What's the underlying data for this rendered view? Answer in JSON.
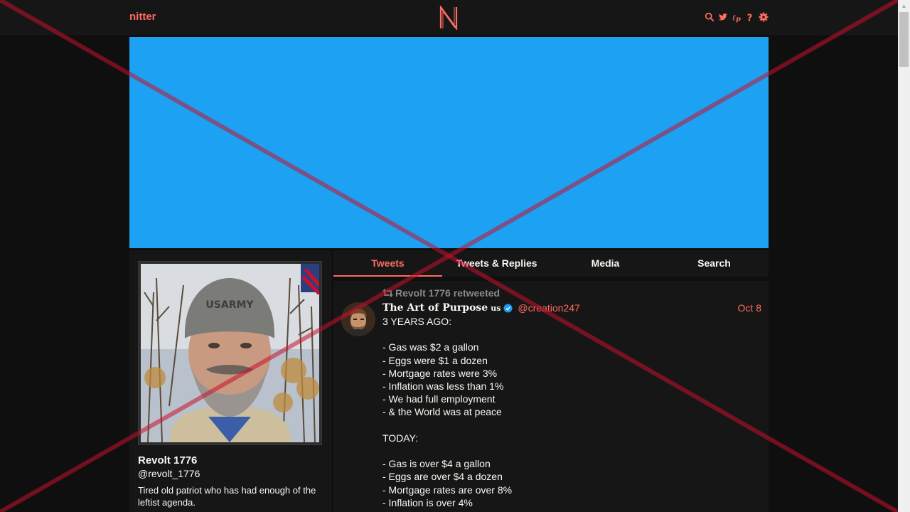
{
  "navbar": {
    "brand": "nitter",
    "logo_letter": "N",
    "icons": [
      "search-icon",
      "twitter-bird-icon",
      "rss-icon",
      "help-icon",
      "gear-icon"
    ]
  },
  "banner": {
    "color": "#1da1f2"
  },
  "profile": {
    "name": "Revolt 1776",
    "handle": "@revolt_1776",
    "bio": "Tired old patriot who has had enough of the leftist agenda.",
    "beanie_text": "USARMY"
  },
  "tabs": [
    {
      "label": "Tweets",
      "active": true
    },
    {
      "label": "Tweets & Replies",
      "active": false
    },
    {
      "label": "Media",
      "active": false
    },
    {
      "label": "Search",
      "active": false
    }
  ],
  "tweet": {
    "retweet_header": "Revolt 1776 retweeted",
    "fullname": "The Art of Purpose",
    "flag": "us",
    "verified": true,
    "username": "@creation247",
    "date": "Oct 8",
    "lines": [
      "3 YEARS AGO:",
      "",
      "- Gas was $2 a gallon",
      "- Eggs were $1 a dozen",
      "- Mortgage rates were 3%",
      "- Inflation was less than 1%",
      "- We had full employment",
      "- & the World was at peace",
      "",
      "TODAY:",
      "",
      "- Gas is over $4 a gallon",
      "- Eggs are over $4 a dozen",
      "- Mortgage rates are over 8%",
      "- Inflation is over 4%"
    ]
  },
  "colors": {
    "accent": "#ff6c60",
    "background": "#0f0f0f",
    "panel": "#161616",
    "text": "#f8f8f2",
    "muted": "#888889",
    "overlay_x": "#c8102e"
  }
}
